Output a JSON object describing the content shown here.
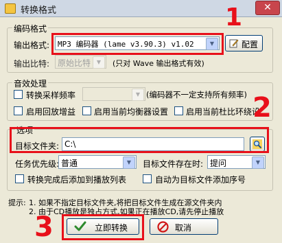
{
  "window": {
    "title": "转换格式",
    "close": "✕"
  },
  "encoding": {
    "group_label": "编码格式",
    "format_label": "输出格式:",
    "format_value": "MP3 编码器 (lame v3.90.3) v1.02",
    "config_button": "配置",
    "bitrate_label": "输出比特:",
    "bitrate_value": "原始比特",
    "bitrate_note": "(只对 Wave 输出格式有效)"
  },
  "effects": {
    "group_label": "音效处理",
    "convert_rate_label": "转换采样频率",
    "rate_note": "(编码器不一定支持所有频率)",
    "replay_gain_label": "启用回放增益",
    "eq_label": "启用当前均衡器设置",
    "dsp_label": "启用当前杜比环绕设"
  },
  "options": {
    "group_label": "选项",
    "folder_label": "目标文件夹:",
    "folder_value": "C:\\",
    "priority_label": "任务优先级:",
    "priority_value": "普通",
    "exists_label": "目标文件存在时:",
    "exists_value": "提问",
    "add_playlist_label": "转换完成后添加到播放列表",
    "add_number_label": "自动为目标文件添加序号"
  },
  "hints": {
    "title": "提示:",
    "line1": "1. 如果不指定目标文件夹,将把目标文件生成在源文件夹内",
    "line2": "2. 由于CD播放是独占方式,如果正在播放CD,请先停止播放"
  },
  "buttons": {
    "convert": "立即转换",
    "cancel": "取消"
  },
  "annotations": {
    "n1": "1",
    "n2": "2",
    "n3": "3"
  },
  "colors": {
    "annotation_red": "#e8101a",
    "titlebar": "#cfd8e4",
    "dialog_bg": "#ece9d8"
  }
}
